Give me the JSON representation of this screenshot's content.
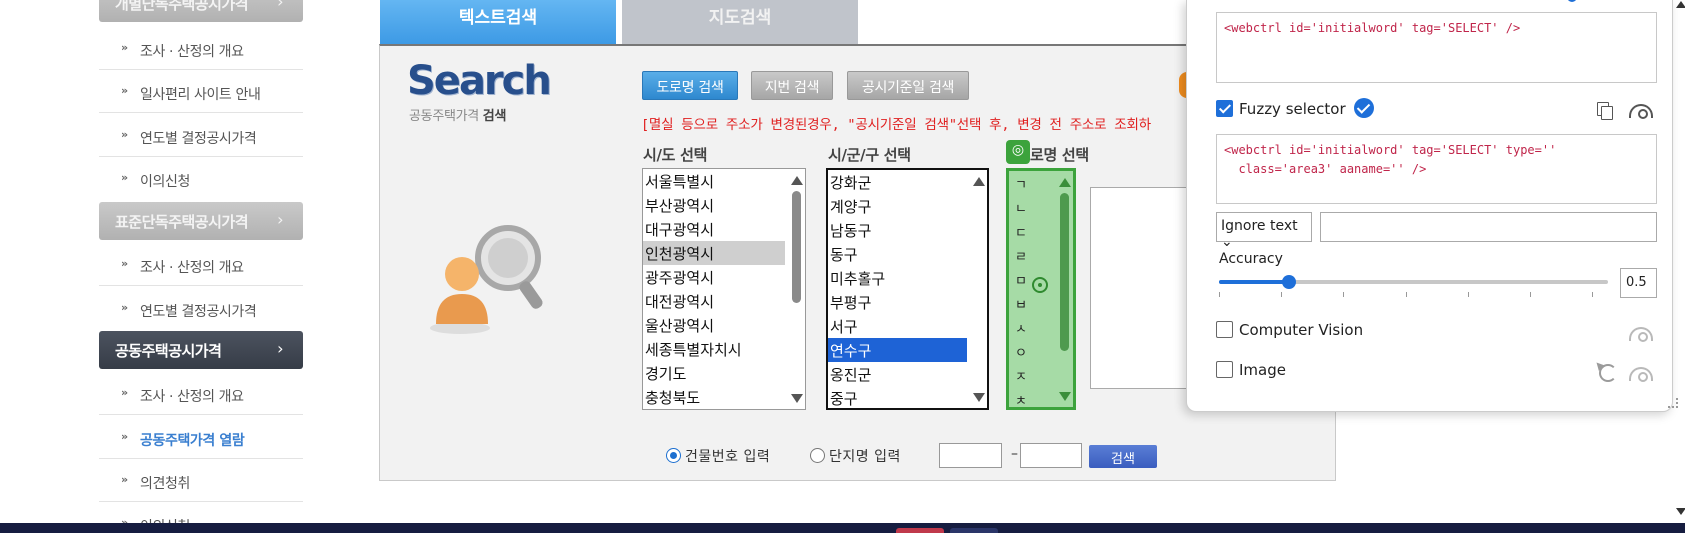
{
  "sidebar": {
    "sections": [
      {
        "title": "개별단독주택공시가격",
        "arrow": "›",
        "style": "gray",
        "items": [
          "조사 · 산정의 개요",
          "일사편리 사이트 안내",
          "연도별 결정공시가격",
          "이의신청"
        ]
      },
      {
        "title": "표준단독주택공시가격",
        "arrow": "›",
        "style": "gray",
        "items": [
          "조사 · 산정의 개요",
          "연도별 결정공시가격"
        ]
      },
      {
        "title": "공동주택공시가격",
        "arrow": "›",
        "style": "dark",
        "items": [
          "조사 · 산정의 개요",
          "공동주택가격 열람",
          "의견청취",
          "이의신청"
        ]
      }
    ],
    "bullet": "»",
    "active_item": "공동주택가격 열람"
  },
  "tabs": {
    "text_search": "텍스트검색",
    "map_search": "지도검색"
  },
  "search": {
    "logo": "Search",
    "subtitle_plain": "공동주택가격 ",
    "subtitle_bold": "검색",
    "buttons": {
      "road": "도로명 검색",
      "lot": "지번 검색",
      "date": "공시기준일 검색"
    },
    "notice": "[멸실 등으로 주소가 변경된경우, \"공시기준일 검색\"선택 후, 변경 전 주소로 조회하",
    "labels": {
      "sido": "시/도 선택",
      "sigungu": "시/군/구 선택",
      "road": "로명 선택"
    },
    "sido_options": [
      "서울특별시",
      "부산광역시",
      "대구광역시",
      "인천광역시",
      "광주광역시",
      "대전광역시",
      "울산광역시",
      "세종특별자치시",
      "경기도",
      "충청북도"
    ],
    "sido_selected": "인천광역시",
    "sigungu_options": [
      "강화군",
      "계양구",
      "남동구",
      "동구",
      "미추홀구",
      "부평구",
      "서구",
      "연수구",
      "옹진군",
      "중구"
    ],
    "sigungu_selected": "연수구",
    "road_initials": [
      "ㄱ",
      "ㄴ",
      "ㄷ",
      "ㄹ",
      "ㅁ",
      "ㅂ",
      "ㅅ",
      "ㅇ",
      "ㅈ",
      "ㅊ"
    ],
    "road_badge_icon": "◎",
    "radio_building": "건물번호 입력",
    "radio_complex": "단지명 입력",
    "dash": "–",
    "search_button": "검색"
  },
  "devtool": {
    "selector_code_tag": "<webctrl id='initialword' tag='SELECT' />",
    "fuzzy_label": "Fuzzy selector",
    "fuzzy_code_line1": "<webctrl id='initialword' tag='SELECT' type=''",
    "fuzzy_code_line2": "  class='area3' aaname='' />",
    "ignore_select": "Ignore text ⌄",
    "accuracy_label": "Accuracy",
    "accuracy_value": "0.5",
    "accuracy_fraction": 0.18,
    "computer_vision_label": "Computer Vision",
    "image_label": "Image",
    "icons": [
      "copy-icon",
      "eye-icon",
      "refresh-icon",
      "verified-icon"
    ]
  },
  "colors": {
    "tab_active": "#3d9ae5",
    "sidebar_dark": "#363c47",
    "notice_red": "#e02020",
    "select_blue": "#1e63d6",
    "road_green": "#3ca33c",
    "accent_blue": "#1e6fd9"
  }
}
